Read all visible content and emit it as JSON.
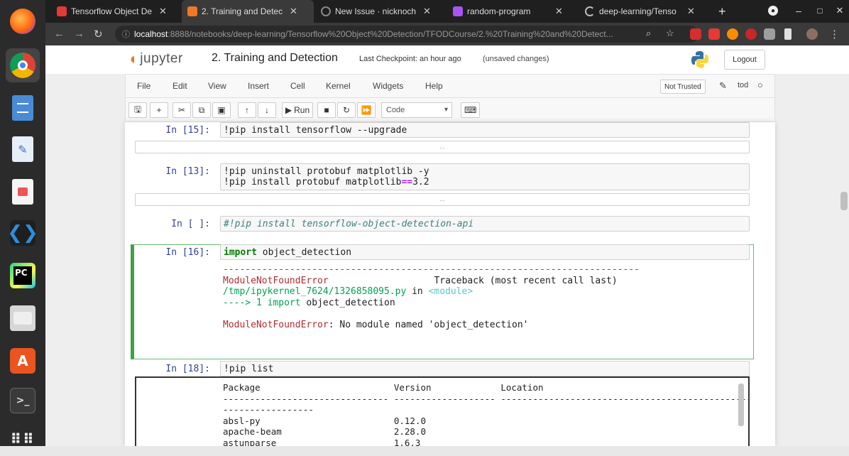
{
  "browser": {
    "tabs": [
      {
        "title": "Tensorflow Object De",
        "icon": "youtube-icon",
        "color": "#e53935"
      },
      {
        "title": "2. Training and Detec",
        "icon": "jupyter-icon",
        "color": "#f37726"
      },
      {
        "title": "New Issue · nicknoch",
        "icon": "github-icon",
        "color": "#333333"
      },
      {
        "title": "random-program",
        "icon": "colab-icon",
        "color": "#a855f7"
      },
      {
        "title": "deep-learning/Tenso",
        "icon": "loading-icon",
        "color": "#bbbbbb"
      }
    ],
    "new_tab": "+",
    "url_host": "localhost",
    "url_path": ":8888/notebooks/deep-learning/Tensorflow%20Object%20Detection/TFODCourse/2.%20Training%20and%20Detect..."
  },
  "jupyter": {
    "logo_text": "jupyter",
    "notebook_title": "2. Training and Detection",
    "checkpoint": "Last Checkpoint: an hour ago",
    "unsaved": "(unsaved changes)",
    "logout": "Logout",
    "menu": [
      "File",
      "Edit",
      "View",
      "Insert",
      "Cell",
      "Kernel",
      "Widgets",
      "Help"
    ],
    "trusted": "Not Trusted",
    "kernel_name": "tod",
    "run_label": "Run",
    "cell_type": "Code"
  },
  "cells": {
    "c1": {
      "prompt": "In [15]:",
      "code": "!pip install tensorflow --upgrade"
    },
    "c2": {
      "prompt": "In [13]:",
      "line1": "!pip uninstall protobuf matplotlib -y",
      "line2a": "!pip install protobuf matplotlib",
      "line2op": "==",
      "line2b": "3.2"
    },
    "c3": {
      "prompt": "In [ ]:",
      "code": "#!pip install tensorflow-object-detection-api"
    },
    "c4": {
      "prompt": "In [16]:",
      "kw": "import",
      "rest": " object_detection",
      "dashes": "---------------------------------------------------------------------------",
      "err_name": "ModuleNotFoundError",
      "traceback": "Traceback (most recent call last)",
      "file": "/tmp/ipykernel_7624/1326858095.py",
      "in_word": " in ",
      "module": "<module>",
      "arrow": "----> 1 ",
      "arrow_kw": "import",
      "arrow_rest": " object_detection",
      "err2": "ModuleNotFoundError",
      "err_msg": ": No module named 'object_detection'"
    },
    "c5": {
      "prompt": "In [18]:",
      "code": "!pip list",
      "header": "Package                         Version             Location",
      "dashes": "------------------------------- ------------------- ----------------------------------------------------------",
      "dashes2": "-----------------",
      "rows": [
        "absl-py                         0.12.0",
        "apache-beam                     2.28.0",
        "astunparse                      1.6.3"
      ]
    },
    "collapsed": "..."
  }
}
